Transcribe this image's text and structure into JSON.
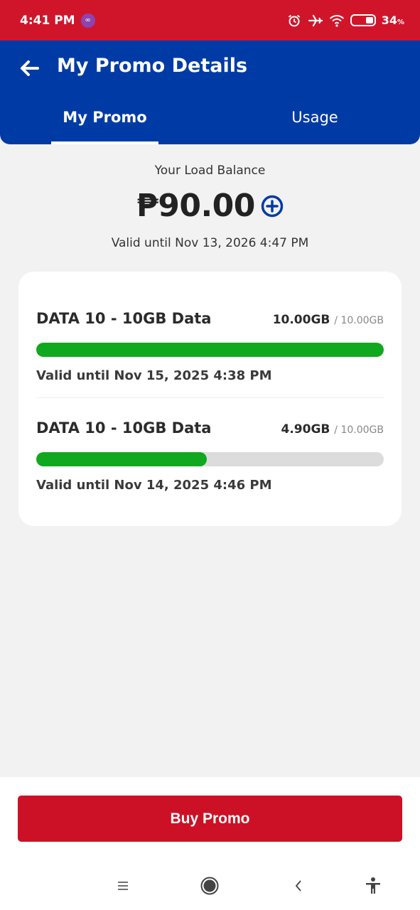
{
  "status_bar": {
    "time": "4:41 PM",
    "battery": "34",
    "battery_unit": "%"
  },
  "header": {
    "title": "My Promo Details",
    "tabs": [
      {
        "label": "My Promo",
        "active": true
      },
      {
        "label": "Usage",
        "active": false
      }
    ]
  },
  "balance": {
    "label": "Your Load Balance",
    "amount": "₱90.00",
    "valid_until": "Valid until Nov 13, 2026 4:47 PM"
  },
  "promos": [
    {
      "name": "DATA 10 - 10GB Data",
      "remaining": "10.00GB",
      "total": "/ 10.00GB",
      "remaining_fraction": 1.0,
      "valid_until": "Valid until Nov 15, 2025 4:38 PM"
    },
    {
      "name": "DATA 10 - 10GB Data",
      "remaining": "4.90GB",
      "total": "/ 10.00GB",
      "remaining_fraction": 0.49,
      "valid_until": "Valid until Nov 14, 2025 4:46 PM"
    }
  ],
  "actions": {
    "buy_label": "Buy Promo"
  },
  "colors": {
    "status_red": "#d0152b",
    "header_blue": "#003ba5",
    "progress_green": "#10a81e",
    "button_red": "#cc1126"
  },
  "icons": [
    "back-arrow-icon",
    "add-circle-icon",
    "alarm-icon",
    "airplane-icon",
    "wifi-icon",
    "battery-icon",
    "menu-icon",
    "home-icon",
    "back-icon",
    "accessibility-icon"
  ]
}
